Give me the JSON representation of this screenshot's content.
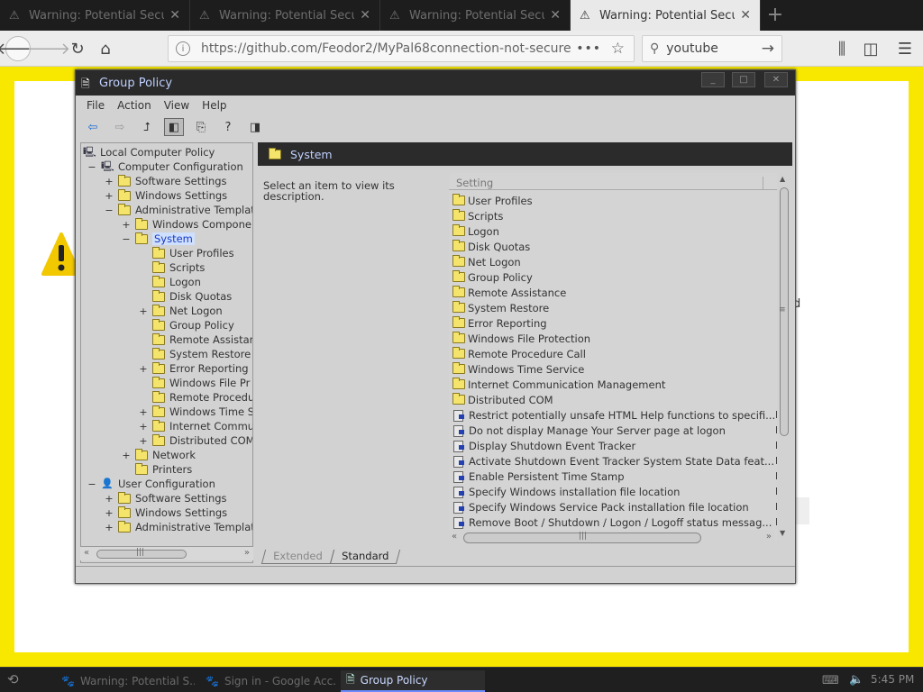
{
  "browser": {
    "tabs": [
      {
        "label": "Warning: Potential Securi",
        "active": false
      },
      {
        "label": "Warning: Potential Securi",
        "active": false
      },
      {
        "label": "Warning: Potential Securi",
        "active": false
      },
      {
        "label": "Warning: Potential Securit",
        "active": true
      }
    ],
    "new_tab_icon": "plus-icon",
    "url": "https://github.com/Feodor2/MyPal68connection-not-secure",
    "url_menu": "•••",
    "search_value": "youtube"
  },
  "page": {
    "partial_text": "d"
  },
  "window": {
    "title": "Group Policy",
    "buttons": [
      "_",
      "□",
      "✕"
    ],
    "menu": [
      "File",
      "Action",
      "View",
      "Help"
    ]
  },
  "tree": {
    "nodes": [
      {
        "label": "Local Computer Policy",
        "level": 0,
        "expander": "",
        "icon": "computer"
      },
      {
        "label": "Computer Configuration",
        "level": 1,
        "expander": "−",
        "icon": "computer"
      },
      {
        "label": "Software Settings",
        "level": 2,
        "expander": "+",
        "icon": "folder"
      },
      {
        "label": "Windows Settings",
        "level": 2,
        "expander": "+",
        "icon": "folder"
      },
      {
        "label": "Administrative Templat",
        "level": 2,
        "expander": "−",
        "icon": "folder"
      },
      {
        "label": "Windows Componen",
        "level": 3,
        "expander": "+",
        "icon": "folder"
      },
      {
        "label": "System",
        "level": 3,
        "expander": "−",
        "icon": "folder",
        "selected": true
      },
      {
        "label": "User Profiles",
        "level": 4,
        "expander": "",
        "icon": "folder"
      },
      {
        "label": "Scripts",
        "level": 4,
        "expander": "",
        "icon": "folder"
      },
      {
        "label": "Logon",
        "level": 4,
        "expander": "",
        "icon": "folder"
      },
      {
        "label": "Disk Quotas",
        "level": 4,
        "expander": "",
        "icon": "folder"
      },
      {
        "label": "Net Logon",
        "level": 4,
        "expander": "+",
        "icon": "folder"
      },
      {
        "label": "Group Policy",
        "level": 4,
        "expander": "",
        "icon": "folder"
      },
      {
        "label": "Remote Assistan",
        "level": 4,
        "expander": "",
        "icon": "folder"
      },
      {
        "label": "System Restore",
        "level": 4,
        "expander": "",
        "icon": "folder"
      },
      {
        "label": "Error Reporting",
        "level": 4,
        "expander": "+",
        "icon": "folder"
      },
      {
        "label": "Windows File Pr",
        "level": 4,
        "expander": "",
        "icon": "folder"
      },
      {
        "label": "Remote Procedu",
        "level": 4,
        "expander": "",
        "icon": "folder"
      },
      {
        "label": "Windows Time S",
        "level": 4,
        "expander": "+",
        "icon": "folder"
      },
      {
        "label": "Internet Commu",
        "level": 4,
        "expander": "+",
        "icon": "folder"
      },
      {
        "label": "Distributed COM",
        "level": 4,
        "expander": "+",
        "icon": "folder"
      },
      {
        "label": "Network",
        "level": 3,
        "expander": "+",
        "icon": "folder"
      },
      {
        "label": "Printers",
        "level": 3,
        "expander": "",
        "icon": "folder"
      },
      {
        "label": "User Configuration",
        "level": 1,
        "expander": "−",
        "icon": "computer"
      },
      {
        "label": "Software Settings",
        "level": 2,
        "expander": "+",
        "icon": "folder"
      },
      {
        "label": "Windows Settings",
        "level": 2,
        "expander": "+",
        "icon": "folder"
      },
      {
        "label": "Administrative Templat",
        "level": 2,
        "expander": "+",
        "icon": "folder"
      }
    ]
  },
  "pane": {
    "header": "System",
    "description": "Select an item to view its description.",
    "column_setting": "Setting",
    "items": [
      {
        "label": "User Profiles",
        "type": "folder",
        "state": ""
      },
      {
        "label": "Scripts",
        "type": "folder",
        "state": ""
      },
      {
        "label": "Logon",
        "type": "folder",
        "state": ""
      },
      {
        "label": "Disk Quotas",
        "type": "folder",
        "state": ""
      },
      {
        "label": "Net Logon",
        "type": "folder",
        "state": ""
      },
      {
        "label": "Group Policy",
        "type": "folder",
        "state": ""
      },
      {
        "label": "Remote Assistance",
        "type": "folder",
        "state": ""
      },
      {
        "label": "System Restore",
        "type": "folder",
        "state": ""
      },
      {
        "label": "Error Reporting",
        "type": "folder",
        "state": ""
      },
      {
        "label": "Windows File Protection",
        "type": "folder",
        "state": ""
      },
      {
        "label": "Remote Procedure Call",
        "type": "folder",
        "state": ""
      },
      {
        "label": "Windows Time Service",
        "type": "folder",
        "state": ""
      },
      {
        "label": "Internet Communication Management",
        "type": "folder",
        "state": ""
      },
      {
        "label": "Distributed COM",
        "type": "folder",
        "state": ""
      },
      {
        "label": "Restrict potentially unsafe HTML Help functions to specifi...",
        "type": "policy",
        "state": "N"
      },
      {
        "label": "Do not display Manage Your Server page at logon",
        "type": "policy",
        "state": "N"
      },
      {
        "label": "Display Shutdown Event Tracker",
        "type": "policy",
        "state": "N"
      },
      {
        "label": "Activate Shutdown Event Tracker System State Data feat...",
        "type": "policy",
        "state": "N"
      },
      {
        "label": "Enable Persistent Time Stamp",
        "type": "policy",
        "state": "N"
      },
      {
        "label": "Specify Windows installation file location",
        "type": "policy",
        "state": "N"
      },
      {
        "label": "Specify Windows Service Pack installation file location",
        "type": "policy",
        "state": "N"
      },
      {
        "label": "Remove Boot / Shutdown / Logon / Logoff status messag...",
        "type": "policy",
        "state": "N"
      }
    ],
    "tabs": [
      "Extended",
      "Standard"
    ]
  },
  "taskbar": {
    "items": [
      {
        "label": "Warning: Potential S...",
        "active": false
      },
      {
        "label": "Sign in - Google Acc...",
        "active": false
      },
      {
        "label": "Group Policy",
        "active": true
      }
    ],
    "clock": "5:45 PM"
  }
}
